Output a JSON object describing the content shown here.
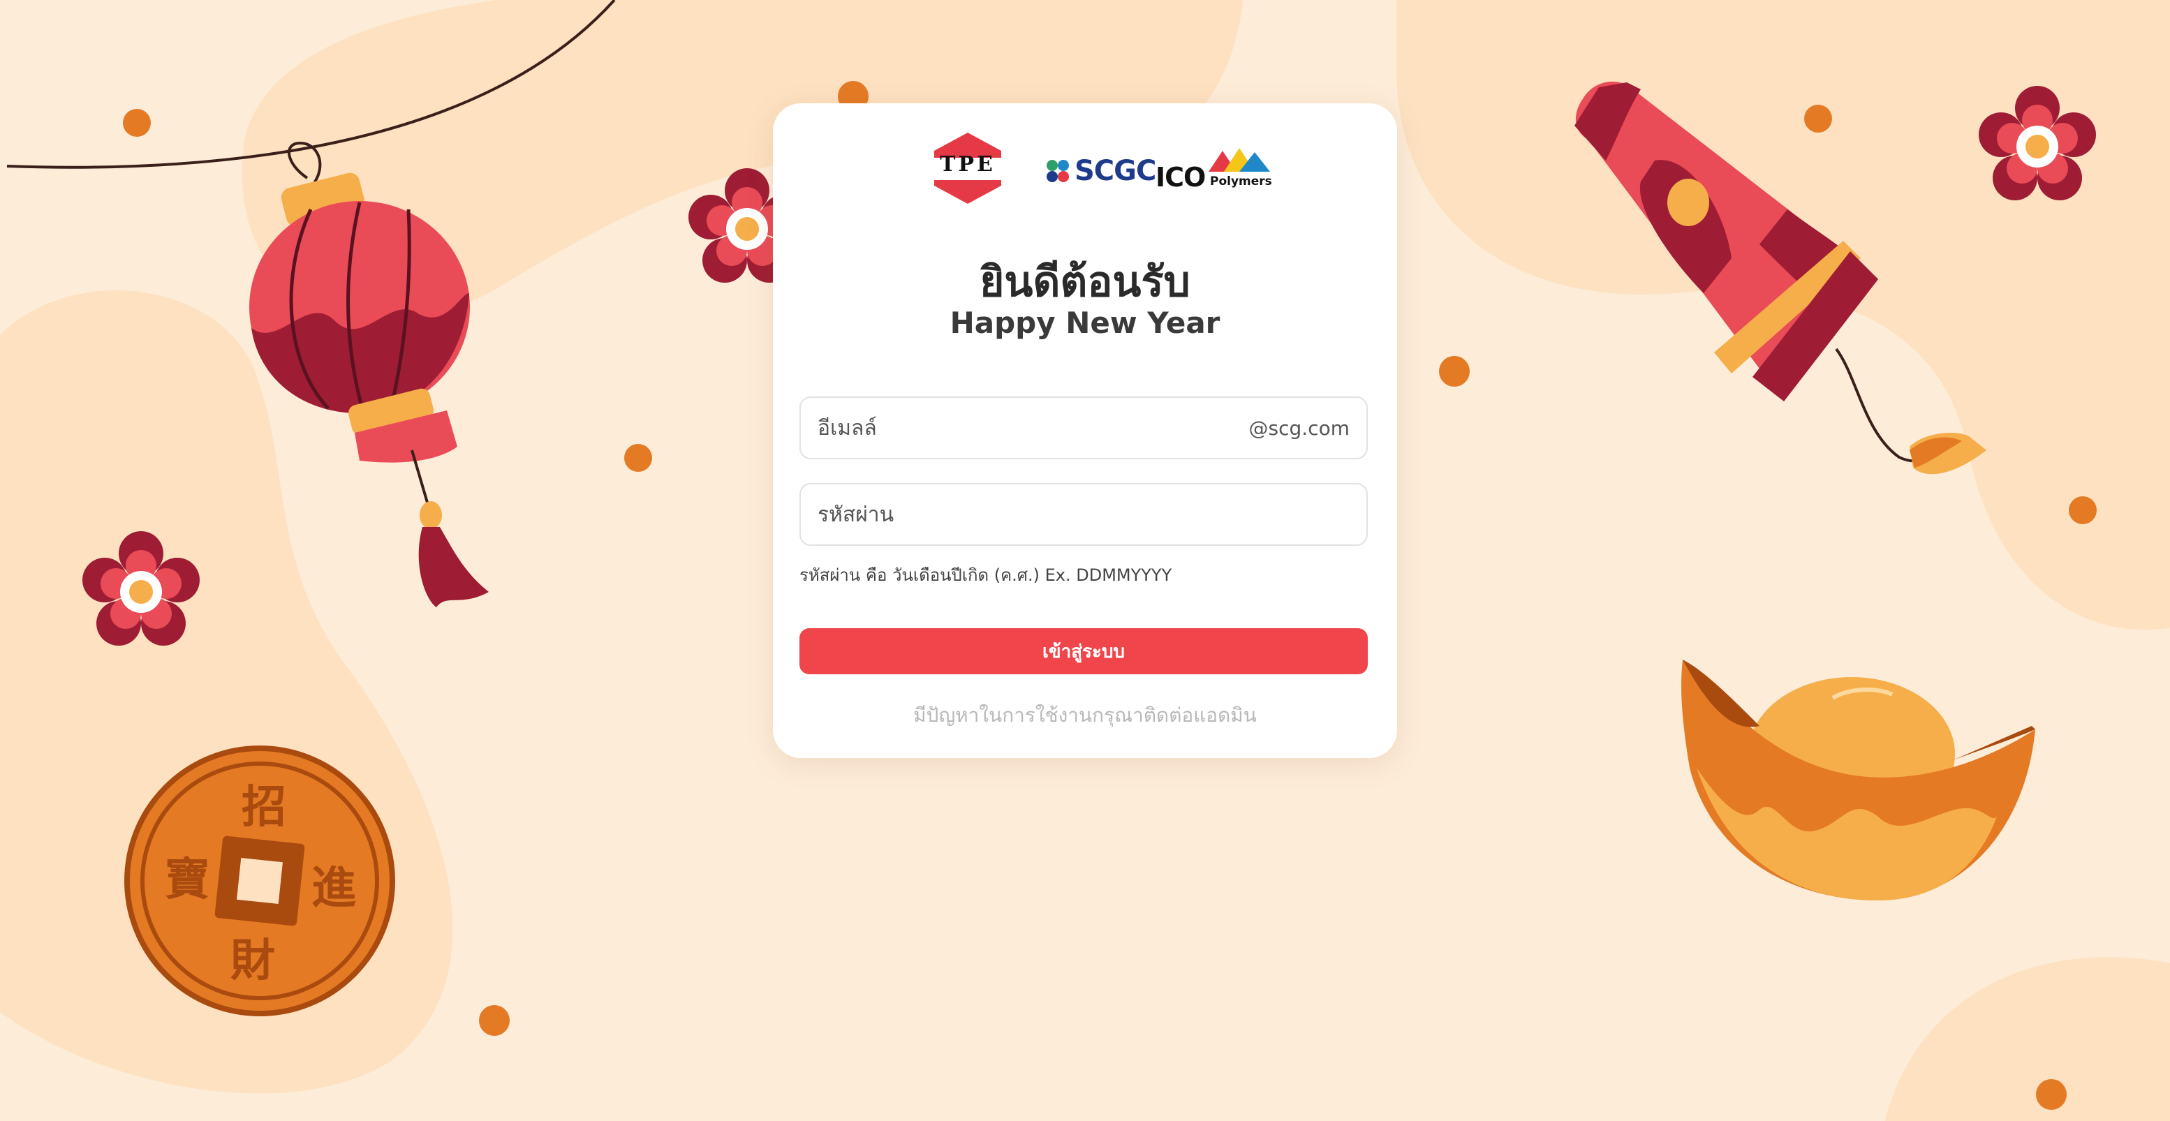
{
  "logos": {
    "tpe": "TPE",
    "scgc": "SCGC",
    "ico": "ICO",
    "ico_sub": "Polymers"
  },
  "welcome": {
    "title": "ยินดีต้อนรับ",
    "subtitle": "Happy New Year"
  },
  "form": {
    "email_placeholder": "อีเมลล์",
    "email_suffix": "@scg.com",
    "password_placeholder": "รหัสผ่าน",
    "password_hint": "รหัสผ่าน คือ วันเดือนปีเกิด (ค.ศ.) Ex. DDMMYYYY",
    "login_label": "เข้าสู่ระบบ",
    "help_text": "มีปัญหาในการใช้งานกรุณาติดต่อแอดมิน"
  },
  "decor": {
    "coin_chars": [
      "招",
      "進",
      "財",
      "寶"
    ]
  },
  "colors": {
    "background": "#fdecd8",
    "accent": "#f0454a",
    "lantern": "#e94b57",
    "gold": "#e47a24",
    "card": "#ffffff"
  }
}
